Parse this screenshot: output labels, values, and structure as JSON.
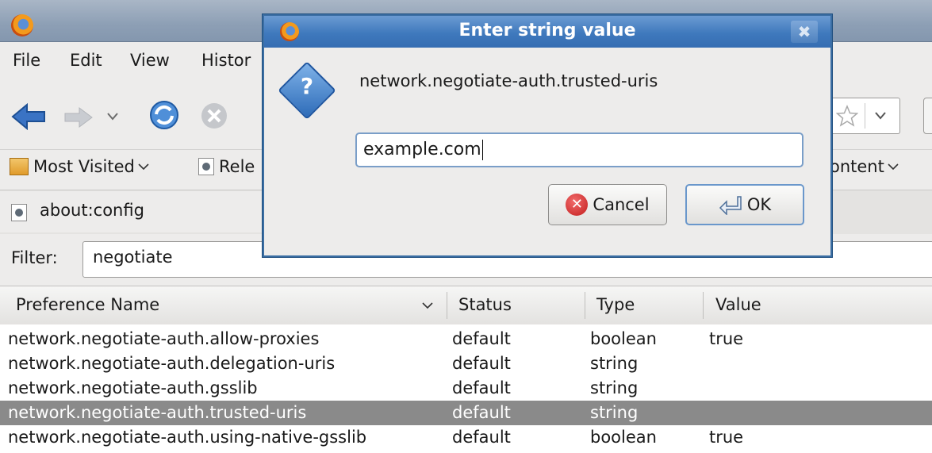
{
  "menubar": {
    "file": "File",
    "edit": "Edit",
    "view": "View",
    "history": "Histor"
  },
  "bookmarks": {
    "most_visited": "Most Visited",
    "release": "Rele",
    "content": "ontent"
  },
  "tab": {
    "label": "about:config"
  },
  "filter": {
    "label": "Filter:",
    "value": "negotiate"
  },
  "table": {
    "columns": [
      "Preference Name",
      "Status",
      "Type",
      "Value"
    ],
    "rows": [
      {
        "name": "network.negotiate-auth.allow-proxies",
        "status": "default",
        "type": "boolean",
        "value": "true"
      },
      {
        "name": "network.negotiate-auth.delegation-uris",
        "status": "default",
        "type": "string",
        "value": ""
      },
      {
        "name": "network.negotiate-auth.gsslib",
        "status": "default",
        "type": "string",
        "value": ""
      },
      {
        "name": "network.negotiate-auth.trusted-uris",
        "status": "default",
        "type": "string",
        "value": ""
      },
      {
        "name": "network.negotiate-auth.using-native-gsslib",
        "status": "default",
        "type": "boolean",
        "value": "true"
      }
    ],
    "selected_row": 3
  },
  "dialog": {
    "title": "Enter string value",
    "message": "network.negotiate-auth.trusted-uris",
    "input_value": "example.com",
    "cancel_label": "Cancel",
    "ok_label": "OK"
  },
  "colors": {
    "titlebar": "#8d9fb5",
    "dialog_title": "#3f79bd",
    "selection": "#8a8a8a"
  },
  "icons": [
    "firefox-icon",
    "back-icon",
    "forward-icon",
    "reload-icon",
    "stop-icon",
    "star-icon",
    "question-icon",
    "cancel-icon",
    "ok-icon",
    "dialog-close-icon"
  ]
}
